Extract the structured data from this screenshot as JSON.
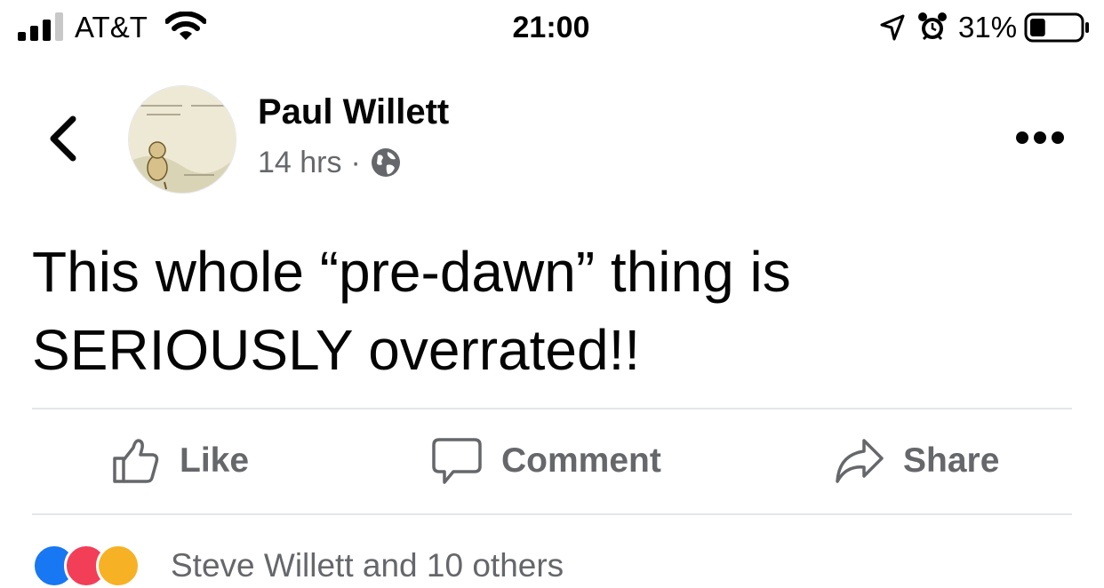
{
  "status_bar": {
    "carrier": "AT&T",
    "time": "21:00",
    "battery_percent": "31%",
    "battery_level": 0.31,
    "icons": [
      "signal-icon",
      "wifi-icon",
      "location-icon",
      "alarm-icon",
      "battery-icon"
    ]
  },
  "post": {
    "author": "Paul Willett",
    "timestamp": "14 hrs",
    "separator": "·",
    "audience_icon": "globe-icon",
    "body": "This whole “pre-dawn” thing is SERIOUSLY overrated!!"
  },
  "nav": {
    "back_icon": "chevron-left-icon",
    "more_icon": "more-horizontal-icon"
  },
  "actions": {
    "like_label": "Like",
    "comment_label": "Comment",
    "share_label": "Share"
  },
  "reactions": {
    "icons": [
      "like-reaction-icon",
      "love-reaction-icon",
      "haha-reaction-icon"
    ],
    "summary": "Steve Willett and 10 others"
  },
  "colors": {
    "secondary_text": "#65676b",
    "divider": "#e4e6eb",
    "like_blue": "#1877f2",
    "love_red": "#f33e58",
    "haha_yellow": "#f7b125"
  }
}
